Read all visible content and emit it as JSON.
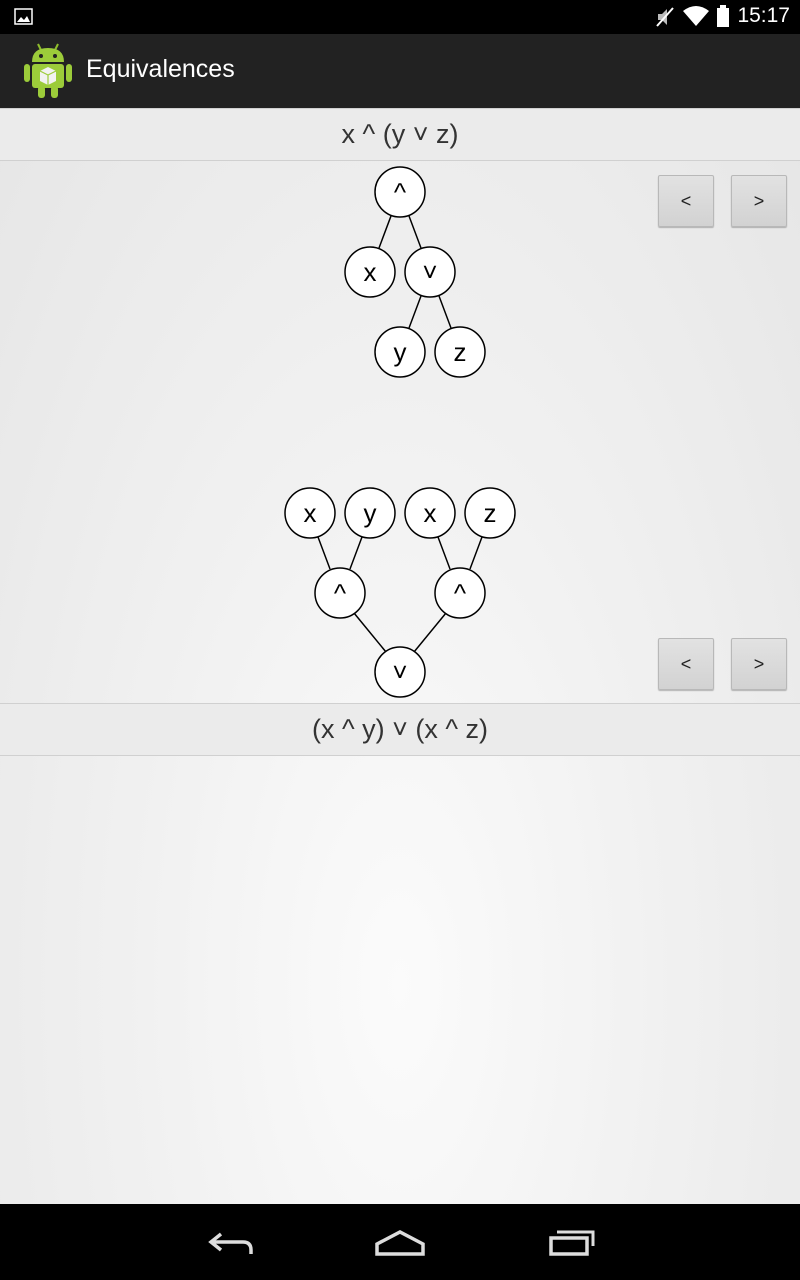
{
  "status_bar": {
    "time": "15:17",
    "icons": [
      "gallery-notification-icon",
      "mute-icon",
      "wifi-icon",
      "battery-icon"
    ]
  },
  "action_bar": {
    "app_icon": "android-robot-icon",
    "title": "Equivalences"
  },
  "top_formula": "x ^ (y ˅ z)",
  "bottom_formula": "(x ^ y) ˅ (x ^ z)",
  "top_tree": {
    "nodes": [
      "^",
      "x",
      "˅",
      "y",
      "z"
    ]
  },
  "bottom_tree": {
    "nodes": [
      "x",
      "y",
      "x",
      "z",
      "^",
      "^",
      "˅"
    ]
  },
  "buttons": {
    "prev_label": "<",
    "next_label": ">"
  },
  "nav_bar": {
    "icons": [
      "back-icon",
      "home-icon",
      "recents-icon"
    ]
  }
}
